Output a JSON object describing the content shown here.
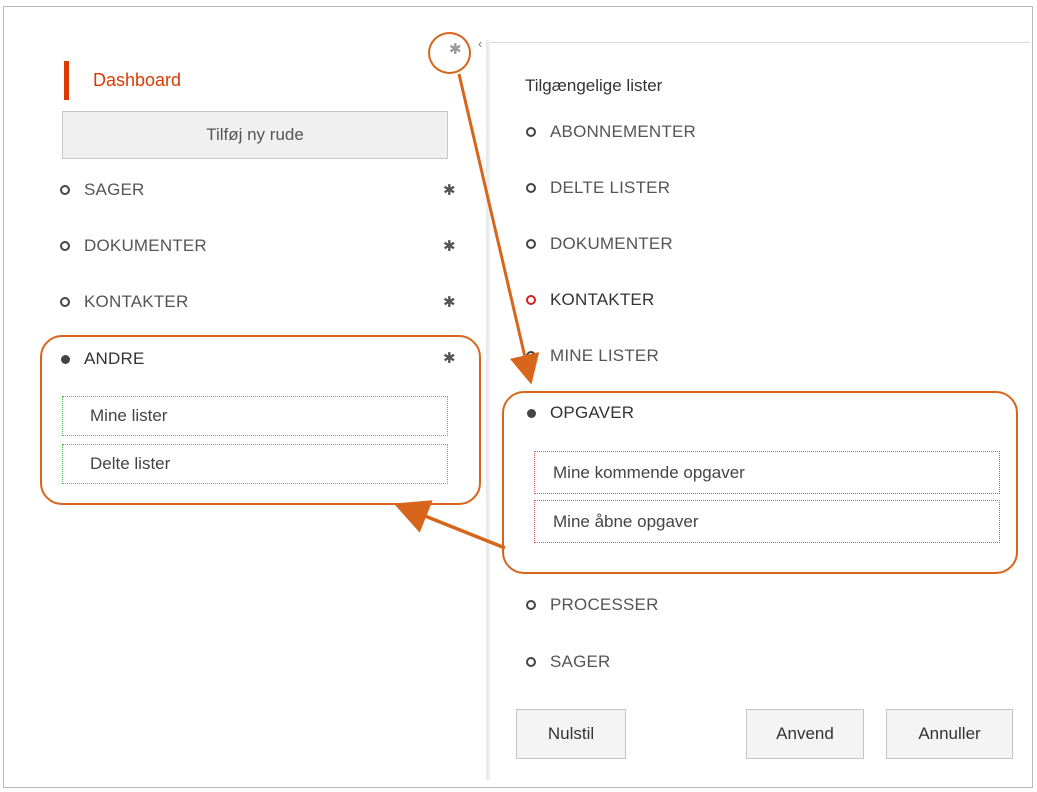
{
  "sidebar": {
    "dashboard_label": "Dashboard",
    "add_pane_label": "Tilføj ny rude",
    "sections": [
      {
        "label": "SAGER"
      },
      {
        "label": "DOKUMENTER"
      },
      {
        "label": "KONTAKTER"
      },
      {
        "label": "ANDRE"
      }
    ],
    "andre_items": [
      "Mine lister",
      "Delte lister"
    ]
  },
  "settings_panel": {
    "title": "Tilgængelige lister",
    "lists": [
      {
        "label": "ABONNEMENTER"
      },
      {
        "label": "DELTE LISTER"
      },
      {
        "label": "DOKUMENTER"
      },
      {
        "label": "KONTAKTER"
      },
      {
        "label": "MINE LISTER"
      },
      {
        "label": "OPGAVER"
      },
      {
        "label": "PROCESSER"
      },
      {
        "label": "SAGER"
      }
    ],
    "opgaver_items": [
      "Mine kommende opgaver",
      "Mine åbne opgaver"
    ],
    "buttons": {
      "reset": "Nulstil",
      "apply": "Anvend",
      "cancel": "Annuller"
    }
  },
  "icons": {
    "settings": "gear-icon",
    "collapse": "chevron-left-icon"
  },
  "colors": {
    "accent": "#d83b01",
    "annotation": "#d7651c",
    "selected_green": "#4cc74c",
    "selected_red": "#e05050"
  }
}
